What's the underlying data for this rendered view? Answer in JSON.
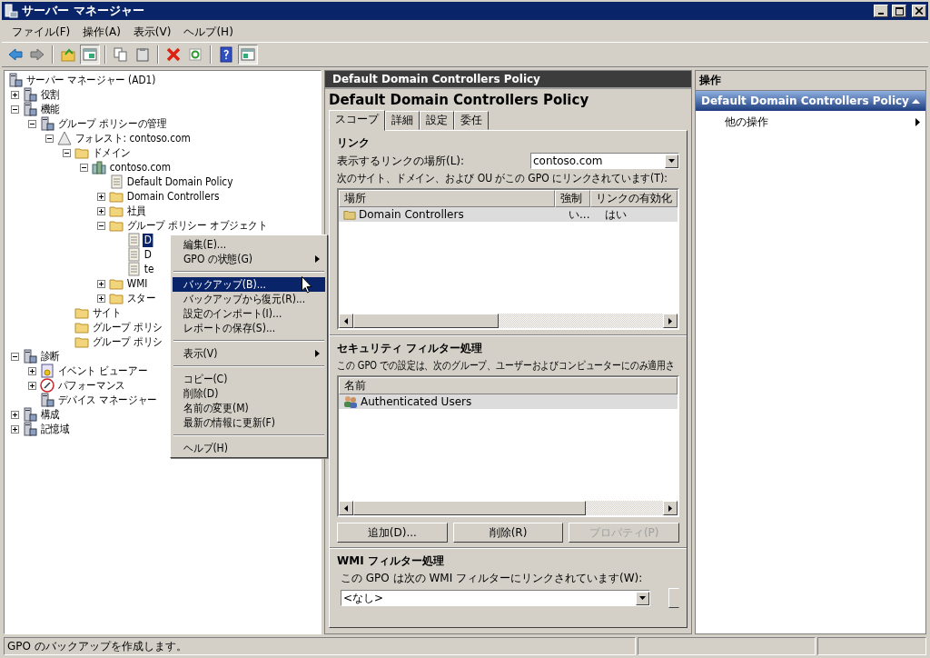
{
  "window": {
    "title": "サーバー マネージャー"
  },
  "menu": [
    "ファイル(F)",
    "操作(A)",
    "表示(V)",
    "ヘルプ(H)"
  ],
  "toolbar": [
    {
      "kind": "back",
      "pressed": false
    },
    {
      "kind": "forward",
      "pressed": false
    },
    {
      "kind": "separator"
    },
    {
      "kind": "up",
      "pressed": false
    },
    {
      "kind": "tree",
      "pressed": true
    },
    {
      "kind": "separator"
    },
    {
      "kind": "copy",
      "pressed": false
    },
    {
      "kind": "paste",
      "pressed": false
    },
    {
      "kind": "separator"
    },
    {
      "kind": "delete",
      "pressed": false
    },
    {
      "kind": "refresh",
      "pressed": false
    },
    {
      "kind": "separator"
    },
    {
      "kind": "help",
      "pressed": false
    },
    {
      "kind": "pane",
      "pressed": true
    }
  ],
  "tree": {
    "label": "サーバー マネージャー (AD1)",
    "kind": "computer",
    "selected": false,
    "children": [
      {
        "label": "役割",
        "kind": "computer",
        "selected": false,
        "expanded": false
      },
      {
        "label": "機能",
        "kind": "computer",
        "selected": false,
        "expanded": true,
        "children": [
          {
            "label": "グループ ポリシーの管理",
            "kind": "computer",
            "selected": false,
            "expanded": true,
            "children": [
              {
                "label": "フォレスト: contoso.com",
                "kind": "forest",
                "selected": false,
                "expanded": true,
                "children": [
                  {
                    "label": "ドメイン",
                    "kind": "folder",
                    "selected": false,
                    "expanded": true,
                    "children": [
                      {
                        "label": "contoso.com",
                        "kind": "domain",
                        "selected": false,
                        "expanded": true,
                        "children": [
                          {
                            "label": "Default Domain Policy",
                            "kind": "policy",
                            "selected": false
                          },
                          {
                            "label": "Domain Controllers",
                            "kind": "folder",
                            "selected": false,
                            "expanded": false
                          },
                          {
                            "label": "社員",
                            "kind": "folder",
                            "selected": false,
                            "expanded": false
                          },
                          {
                            "label": "グループ ポリシー オブジェクト",
                            "kind": "folder",
                            "selected": false,
                            "expanded": true,
                            "children": [
                              {
                                "label": "D",
                                "kind": "policy",
                                "selected": true
                              },
                              {
                                "label": "D",
                                "kind": "policy",
                                "selected": false
                              },
                              {
                                "label": "te",
                                "kind": "policy",
                                "selected": false
                              }
                            ]
                          },
                          {
                            "label": "WMI",
                            "kind": "folder",
                            "selected": false,
                            "expanded": false
                          },
                          {
                            "label": "スター",
                            "kind": "folder",
                            "selected": false,
                            "expanded": false
                          }
                        ]
                      }
                    ]
                  },
                  {
                    "label": "サイト",
                    "kind": "folder",
                    "selected": false
                  },
                  {
                    "label": "グループ ポリシ",
                    "kind": "folder",
                    "selected": false
                  },
                  {
                    "label": "グループ ポリシ",
                    "kind": "folder",
                    "selected": false
                  }
                ]
              }
            ]
          }
        ]
      },
      {
        "label": "診断",
        "kind": "computer",
        "selected": false,
        "expanded": true,
        "children": [
          {
            "label": "イベント ビューアー",
            "kind": "log",
            "selected": false,
            "expanded": false
          },
          {
            "label": "パフォーマンス",
            "kind": "gauge",
            "selected": false,
            "expanded": false
          },
          {
            "label": "デバイス マネージャー",
            "kind": "computer",
            "selected": false
          }
        ]
      },
      {
        "label": "構成",
        "kind": "computer",
        "selected": false,
        "expanded": false
      },
      {
        "label": "記憶域",
        "kind": "computer",
        "selected": false,
        "expanded": false
      }
    ]
  },
  "context_menu": [
    {
      "kind": "item",
      "label": "編集(E)...",
      "submenu": false,
      "selected": false
    },
    {
      "kind": "item",
      "label": "GPO の状態(G)",
      "submenu": true,
      "selected": false
    },
    {
      "kind": "separator"
    },
    {
      "kind": "item",
      "label": "バックアップ(B)...",
      "submenu": false,
      "selected": true
    },
    {
      "kind": "item",
      "label": "バックアップから復元(R)...",
      "submenu": false,
      "selected": false
    },
    {
      "kind": "item",
      "label": "設定のインポート(I)...",
      "submenu": false,
      "selected": false
    },
    {
      "kind": "item",
      "label": "レポートの保存(S)...",
      "submenu": false,
      "selected": false
    },
    {
      "kind": "separator"
    },
    {
      "kind": "item",
      "label": "表示(V)",
      "submenu": true,
      "selected": false
    },
    {
      "kind": "separator"
    },
    {
      "kind": "item",
      "label": "コピー(C)",
      "submenu": false,
      "selected": false
    },
    {
      "kind": "item",
      "label": "削除(D)",
      "submenu": false,
      "selected": false
    },
    {
      "kind": "item",
      "label": "名前の変更(M)",
      "submenu": false,
      "selected": false
    },
    {
      "kind": "item",
      "label": "最新の情報に更新(F)",
      "submenu": false,
      "selected": false
    },
    {
      "kind": "separator"
    },
    {
      "kind": "item",
      "label": "ヘルプ(H)",
      "submenu": false,
      "selected": false
    }
  ],
  "details": {
    "header": "Default Domain Controllers Policy",
    "title": "Default Domain Controllers Policy",
    "tabs": [
      {
        "label": "スコープ",
        "selected": true
      },
      {
        "label": "詳細",
        "selected": false
      },
      {
        "label": "設定",
        "selected": false
      },
      {
        "label": "委任",
        "selected": false
      }
    ],
    "links": {
      "heading": "リンク",
      "location_label": "表示するリンクの場所(L):",
      "location_value": "contoso.com",
      "list_label": "次のサイト、ドメイン、および OU がこの GPO にリンクされています(T):",
      "columns": [
        "場所",
        "強制",
        "リンクの有効化"
      ],
      "rows": [
        {
          "cells": [
            "Domain Controllers",
            "い...",
            "はい"
          ],
          "selected": true
        }
      ]
    },
    "security": {
      "heading": "セキュリティ フィルター処理",
      "description": "この GPO での設定は、次のグループ、ユーザーおよびコンピューターにのみ適用さ",
      "columns": [
        "名前"
      ],
      "rows": [
        {
          "cells": [
            "Authenticated Users"
          ],
          "selected": true
        }
      ],
      "buttons": [
        {
          "label": "追加(D)...",
          "disabled": false
        },
        {
          "label": "削除(R)",
          "disabled": false
        },
        {
          "label": "プロパティ(P)",
          "disabled": true
        }
      ]
    },
    "wmi": {
      "heading": "WMI フィルター処理",
      "description": "この GPO は次の WMI フィルターにリンクされています(W):",
      "value": "<なし>"
    }
  },
  "actions": {
    "header": "操作",
    "group": "Default Domain Controllers Policy",
    "items": [
      {
        "label": "他の操作",
        "submenu": true
      }
    ]
  },
  "status_bar": [
    "GPO のバックアップを作成します。"
  ]
}
